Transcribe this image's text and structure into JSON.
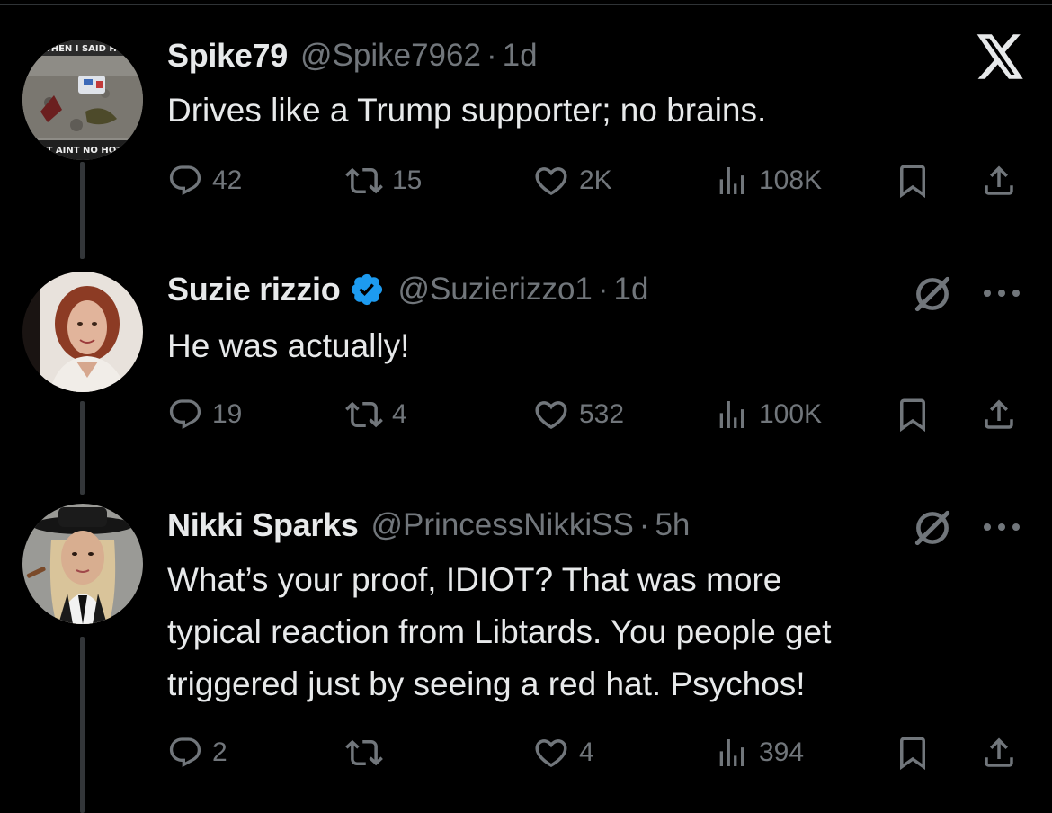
{
  "app": {
    "logo_icon": "x-logo-icon"
  },
  "tweets": [
    {
      "name": "Spike79",
      "verified": false,
      "handle": "@Spike7962",
      "separator": "·",
      "time": "1d",
      "text": "Drives like a Trump supporter; no brains.",
      "avatar_text_top": "WHEN I SAID HO",
      "avatar_text_bottom": "IT AINT NO HOT",
      "replies": "42",
      "reposts": "15",
      "likes": "2K",
      "views": "108K"
    },
    {
      "name": "Suzie rizzio",
      "verified": true,
      "handle": "@Suzierizzo1",
      "separator": "·",
      "time": "1d",
      "text": "He was actually!",
      "replies": "19",
      "reposts": "4",
      "likes": "532",
      "views": "100K"
    },
    {
      "name": "Nikki Sparks",
      "verified": false,
      "handle": "@PrincessNikkiSS",
      "separator": "·",
      "time": "5h",
      "text_lines": [
        "What’s your proof, IDIOT? That was more",
        "typical reaction from Libtards. You people get",
        "triggered just by seeing a red hat. Psychos!"
      ],
      "replies": "2",
      "reposts": "",
      "likes": "4",
      "views": "394"
    }
  ],
  "colors": {
    "background": "#000000",
    "text_primary": "#e7e9ea",
    "text_secondary": "#71767b",
    "verified_blue": "#1d9bf0",
    "thread_line": "#333639"
  }
}
